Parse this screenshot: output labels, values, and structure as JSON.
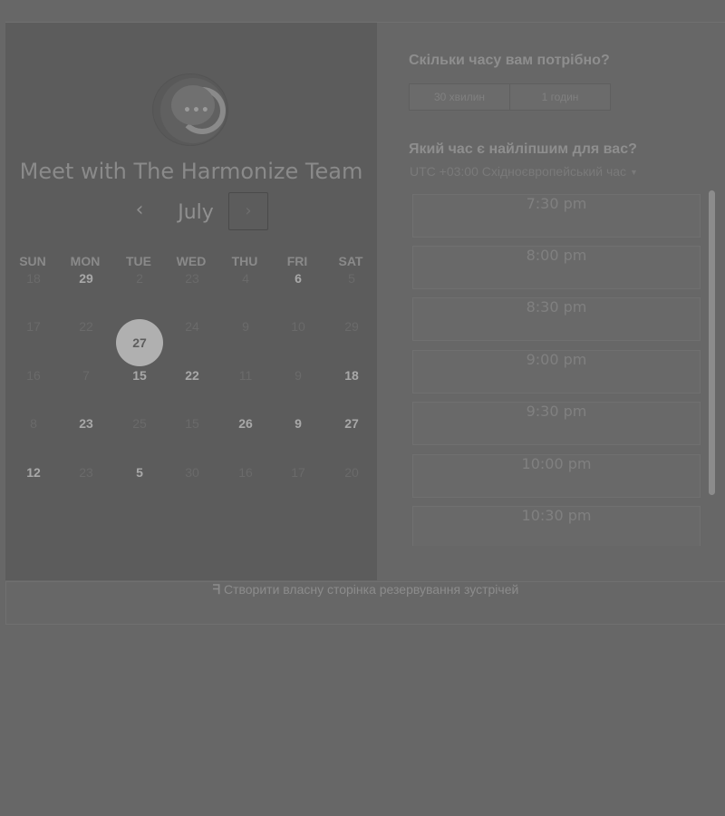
{
  "left": {
    "title": "Meet with The Harmonize Team",
    "month": "July",
    "prev_icon": "‹",
    "next_icon": "›",
    "weekdays": [
      "SUN",
      "MON",
      "TUE",
      "WED",
      "THU",
      "FRI",
      "SAT"
    ],
    "weeks": [
      [
        "18",
        "29",
        "2",
        "23",
        "4",
        "6",
        "5"
      ],
      [
        "17",
        "22",
        "27",
        "24",
        "9",
        "10",
        "29"
      ],
      [
        "16",
        "7",
        "15",
        "22",
        "11",
        "9",
        "18"
      ],
      [
        "8",
        "23",
        "25",
        "15",
        "26",
        "9",
        "27"
      ],
      [
        "12",
        "23",
        "5",
        "30",
        "16",
        "17",
        "20"
      ]
    ]
  },
  "right": {
    "duration_question": "Скільки часу вам потрібно?",
    "durations": [
      "30 хвилин",
      "1 годин"
    ],
    "time_question": "Який час є найліпшим для вас?",
    "timezone": "UTC +03:00 Східноєвропейський час",
    "slots": [
      "7:30 pm",
      "8:00 pm",
      "8:30 pm",
      "9:00 pm",
      "9:30 pm",
      "10:00 pm",
      "10:30 pm"
    ]
  },
  "footer": {
    "icon": "hubspot-sprocket-icon",
    "text": "Створити власну сторінка резервування зустрічей"
  }
}
